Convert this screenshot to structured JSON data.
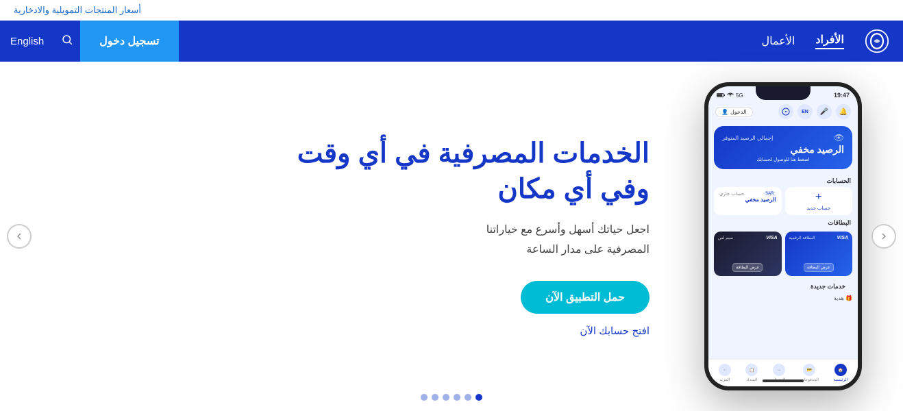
{
  "topbar": {
    "link_text": "أسعار المنتجات التمويلية والادخارية"
  },
  "navbar": {
    "logo_alt": "Alinma Bank Logo",
    "links": [
      {
        "label": "الأفراد",
        "active": true
      },
      {
        "label": "الأعمال",
        "active": false
      }
    ],
    "lang_label": "English",
    "search_label": "Search",
    "login_label": "تسجيل دخول"
  },
  "hero": {
    "title_line1": "الخدمات المصرفية في أي وقت",
    "title_line2": "وفي أي مكان",
    "subtitle_line1": "اجعل حياتك أسهل وأسرع مع خياراتنا",
    "subtitle_line2": "المصرفية على مدار الساعة",
    "cta_primary": "حمل التطبيق الآن",
    "cta_secondary": "افتح حسابك الآن",
    "dots": [
      1,
      2,
      3,
      4,
      5,
      6
    ],
    "active_dot": 0
  },
  "phone": {
    "status_time": "19:47",
    "signal": "5G",
    "balance_label": "إجمالي الرصيد المتوفر",
    "balance_hidden": "الرصيد مخفي",
    "balance_link": "اضغط هنا للوصول لحسابك",
    "accounts_title": "الحسابات",
    "new_account_label": "حساب جديد",
    "existing_account_label": "حساب جاري",
    "existing_account_value": "الرصيد مخفي",
    "cards_title": "البطاقات",
    "card1_label": "البطاقة الرقمية",
    "card1_btn": "عرض البطاقة",
    "card2_label": "سيم لس",
    "card2_btn": "عرض البطاقة",
    "new_services_title": "خدمات جديدة",
    "new_services_item": "هدية",
    "nav_items": [
      "الرئيسية",
      "المدفوعات",
      "التحويل",
      "السداد",
      "المزيد"
    ]
  },
  "arrows": {
    "left": "‹",
    "right": "›"
  }
}
